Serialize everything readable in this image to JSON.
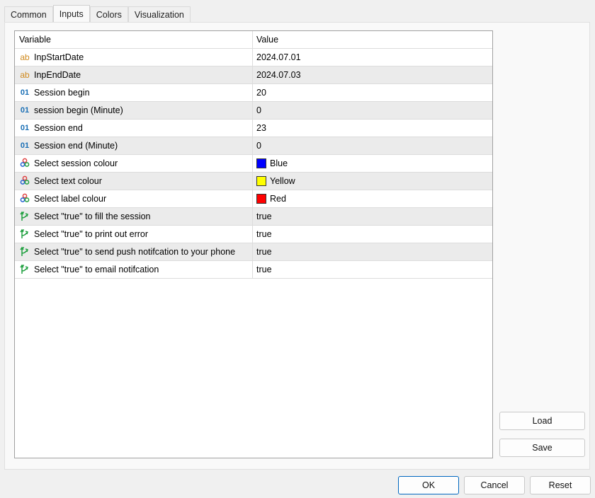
{
  "tabs": [
    "Common",
    "Inputs",
    "Colors",
    "Visualization"
  ],
  "active_tab": "Inputs",
  "table": {
    "headers": [
      "Variable",
      "Value"
    ],
    "rows": [
      {
        "type": "string",
        "icon": "ab",
        "name": "InpStartDate",
        "value": "2024.07.01"
      },
      {
        "type": "string",
        "icon": "ab",
        "name": "InpEndDate",
        "value": "2024.07.03"
      },
      {
        "type": "int",
        "icon": "01",
        "name": "Session begin",
        "value": "20"
      },
      {
        "type": "int",
        "icon": "01",
        "name": "session begin (Minute)",
        "value": "0"
      },
      {
        "type": "int",
        "icon": "01",
        "name": "Session end",
        "value": "23"
      },
      {
        "type": "int",
        "icon": "01",
        "name": "Session end (Minute)",
        "value": "0"
      },
      {
        "type": "color",
        "name": "Select session colour",
        "value": "Blue",
        "color": "#0000ff"
      },
      {
        "type": "color",
        "name": "Select text colour",
        "value": "Yellow",
        "color": "#ffff00"
      },
      {
        "type": "color",
        "name": "Select label colour",
        "value": "Red",
        "color": "#ff0000"
      },
      {
        "type": "bool",
        "name": "Select \"true\" to fill the session",
        "value": "true"
      },
      {
        "type": "bool",
        "name": "Select \"true\" to print out error",
        "value": "true"
      },
      {
        "type": "bool",
        "name": "Select \"true\" to send push notifcation to your phone",
        "value": "true"
      },
      {
        "type": "bool",
        "name": "Select \"true\" to email notifcation",
        "value": "true"
      }
    ]
  },
  "buttons": {
    "load": "Load",
    "save": "Save",
    "ok": "OK",
    "cancel": "Cancel",
    "reset": "Reset"
  }
}
